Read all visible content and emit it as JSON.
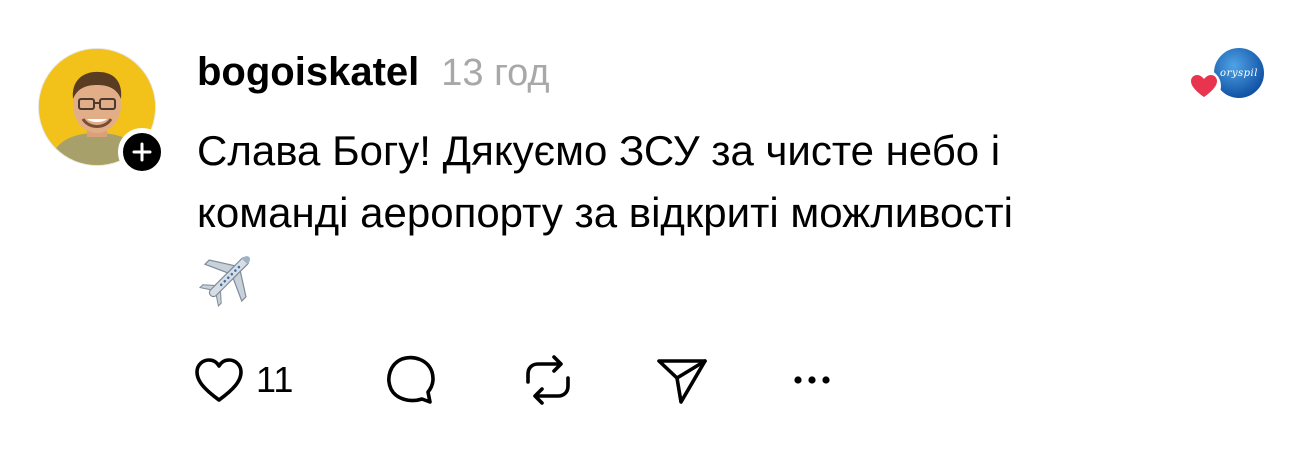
{
  "post": {
    "username": "bogoiskatel",
    "timestamp": "13 год",
    "text_lines": [
      "Слава Богу! Дякуємо ЗСУ за чисте небо і",
      "команді аеропорту за відкриті можливості"
    ],
    "emoji": "✈️",
    "liked_by_avatar_text": "oryspil",
    "actions": {
      "like_count": "11"
    }
  },
  "colors": {
    "timestamp": "#a8a8a8",
    "avatar_bg": "#f2c21a",
    "heart": "#e8344e",
    "liker_avatar": "#1456a8"
  },
  "icons": {
    "follow": "plus-icon",
    "like": "heart-outline-icon",
    "comment": "comment-bubble-icon",
    "repost": "repost-arrows-icon",
    "share": "paper-plane-icon",
    "more": "ellipsis-icon",
    "liked_badge": "heart-filled-icon",
    "emoji": "airplane-emoji"
  }
}
